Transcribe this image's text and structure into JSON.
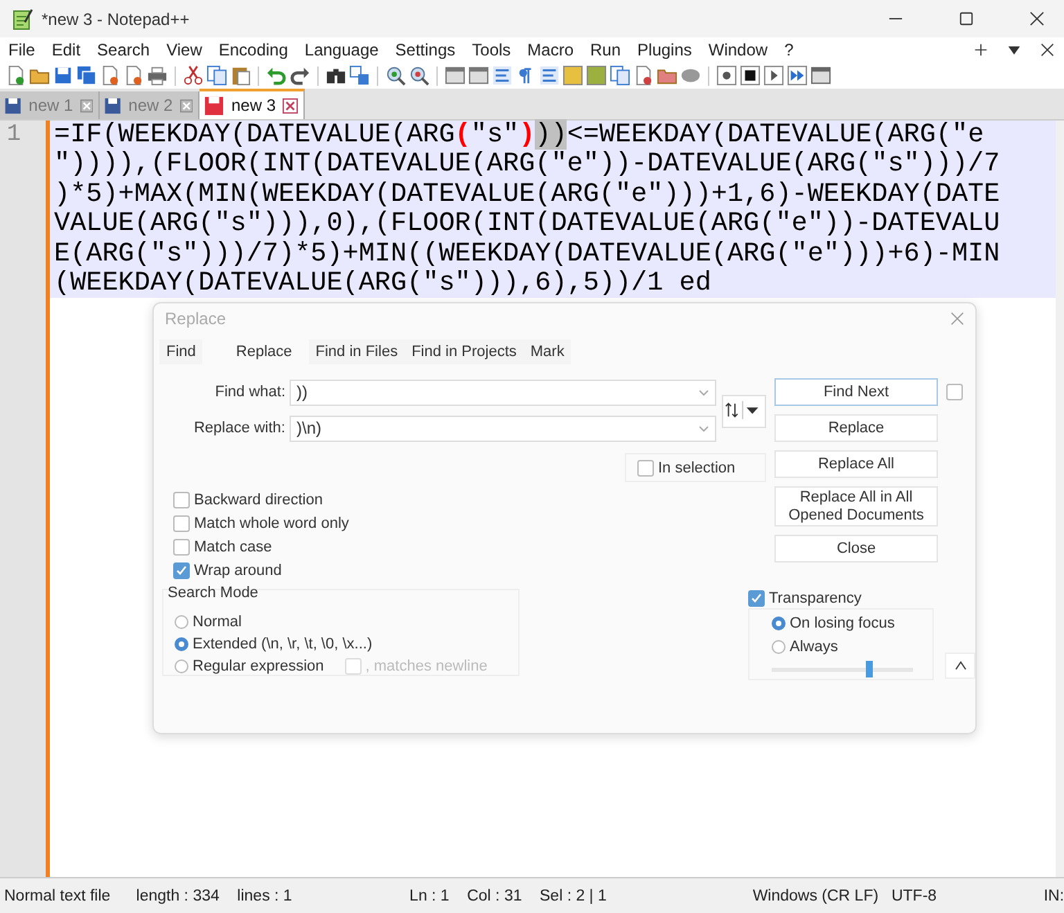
{
  "window": {
    "title": "*new 3 - Notepad++"
  },
  "menu": [
    "File",
    "Edit",
    "Search",
    "View",
    "Encoding",
    "Language",
    "Settings",
    "Tools",
    "Macro",
    "Run",
    "Plugins",
    "Window",
    "?"
  ],
  "tabs": [
    {
      "label": "new 1",
      "selected": false
    },
    {
      "label": "new 2",
      "selected": false
    },
    {
      "label": "new 3",
      "selected": true
    }
  ],
  "editor": {
    "line_number": "1",
    "segments": [
      {
        "kind": "plain",
        "text": "=IF(WEEKDAY(DATEVALUE(ARG"
      },
      {
        "kind": "brace",
        "text": "("
      },
      {
        "kind": "plain",
        "text": "\"s\""
      },
      {
        "kind": "brace",
        "text": ")"
      },
      {
        "kind": "selected",
        "text": "))"
      },
      {
        "kind": "plain",
        "text": "<=WEEKDAY(DATEVALUE(ARG(\"e\")))),(FLOOR(INT(DATEVALUE(ARG(\"e\"))-DATEVALUE(ARG(\"s\")))/7)*5)+MAX(MIN(WEEKDAY(DATEVALUE(ARG(\"e\")))+1,6)-WEEKDAY(DATEVALUE(ARG(\"s\"))),0),(FLOOR(INT(DATEVALUE(ARG(\"e\"))-DATEVALUE(ARG(\"s\")))/7)*5)+MIN((WEEKDAY(DATEVALUE(ARG(\"e\")))+6)-MIN(WEEKDAY(DATEVALUE(ARG(\"s\"))),6),5))/1 ed"
      }
    ]
  },
  "dialog": {
    "title": "Replace",
    "tabs": [
      {
        "label": "Find",
        "selected": false
      },
      {
        "label": "Replace",
        "selected": true
      },
      {
        "label": "Find in Files",
        "selected": false
      },
      {
        "label": "Find in Projects",
        "selected": false
      },
      {
        "label": "Mark",
        "selected": false
      }
    ],
    "find_what": {
      "label": "Find what:",
      "value": "))"
    },
    "replace_with": {
      "label": "Replace with:",
      "value": ")\\n)"
    },
    "in_selection": {
      "label": "In selection",
      "checked": false
    },
    "extra_checkbox": {
      "checked": false
    },
    "buttons": [
      "Find Next",
      "Replace",
      "Replace All",
      "Replace All in All Opened Documents",
      "Close"
    ],
    "options": [
      {
        "label": "Backward direction",
        "checked": false
      },
      {
        "label": "Match whole word only",
        "checked": false
      },
      {
        "label": "Match case",
        "checked": false
      },
      {
        "label": "Wrap around",
        "checked": true
      }
    ],
    "search_mode": {
      "title": "Search Mode",
      "modes": [
        {
          "label": "Normal",
          "selected": false
        },
        {
          "label": "Extended (\\n, \\r, \\t, \\0, \\x...)",
          "selected": true
        },
        {
          "label": "Regular expression",
          "selected": false
        }
      ],
      "matches_newline": {
        "label": ", matches newline",
        "checked": false,
        "disabled": true
      }
    },
    "transparency": {
      "label": "Transparency",
      "checked": true,
      "modes": [
        {
          "label": "On losing focus",
          "selected": true
        },
        {
          "label": "Always",
          "selected": false
        }
      ],
      "level": 0.7
    }
  },
  "status_bar": [
    "Normal text file",
    "length : 334    lines : 1",
    "Ln : 1    Col : 31    Sel : 2 | 1",
    "Windows (CR LF)",
    "UTF-8",
    "IN:"
  ]
}
